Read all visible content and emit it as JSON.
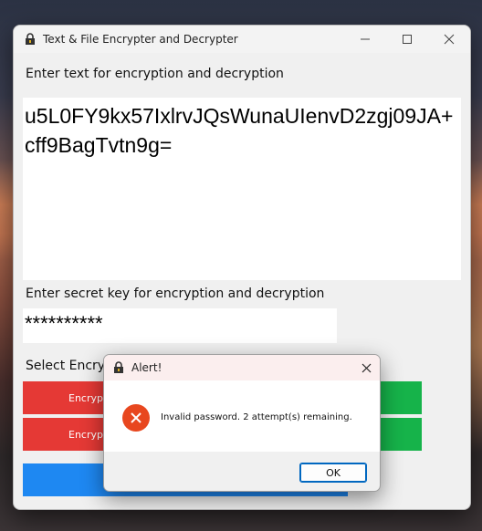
{
  "window": {
    "title": "Text & File Encrypter and Decrypter",
    "icons": {
      "app": "padlock-icon",
      "minimize": "minimize-icon",
      "maximize": "maximize-icon",
      "close": "close-icon"
    }
  },
  "main": {
    "text_label": "Enter text for encryption and decryption",
    "text_value": "u5L0FY9kx57IxlrvJQsWunaUIenvD2zgj09JA+cff9BagTvtn9g=",
    "key_label": "Enter secret key for encryption and decryption",
    "key_value": "**********",
    "select_label": "Select Encry",
    "buttons": {
      "encrypt_1": "Encrypt",
      "encrypt_2": "Encryp"
    }
  },
  "alert": {
    "title": "Alert!",
    "message": "Invalid password. 2 attempt(s) remaining.",
    "ok_label": "OK",
    "icons": {
      "app": "padlock-icon",
      "close": "close-icon",
      "error": "error-icon"
    }
  },
  "colors": {
    "red_button": "#e53935",
    "green_button": "#16b34a",
    "blue_button": "#1e88f2",
    "error": "#e8471f",
    "ok_border": "#0067c0"
  }
}
